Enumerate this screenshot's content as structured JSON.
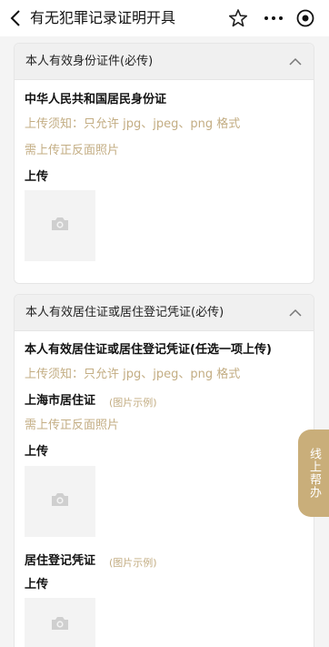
{
  "header": {
    "title": "有无犯罪记录证明开具"
  },
  "section1": {
    "header": "本人有效身份证件(必传)",
    "doc_title": "中华人民共和国居民身份证",
    "notice": "上传须知：只允许 jpg、jpeg、png 格式",
    "requirement": "需上传正反面照片",
    "upload_label": "上传"
  },
  "section2": {
    "header": "本人有效居住证或居住登记凭证(必传)",
    "doc_title": "本人有效居住证或居住登记凭证(任选一项上传)",
    "notice": "上传须知：只允许 jpg、jpeg、png 格式",
    "item1_title": "上海市居住证",
    "item1_example": "(图片示例)",
    "item1_requirement": "需上传正反面照片",
    "item1_upload_label": "上传",
    "item2_title": "居住登记凭证",
    "item2_example": "(图片示例)",
    "item2_upload_label": "上传"
  },
  "side_help": {
    "label": "线上帮办"
  }
}
